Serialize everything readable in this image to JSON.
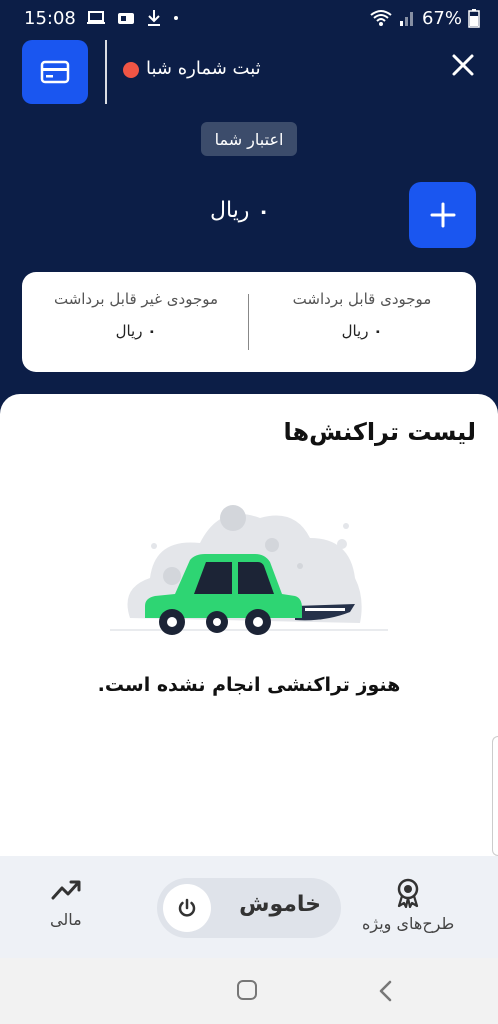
{
  "status_bar": {
    "time": "15:08",
    "battery": "67%"
  },
  "header": {
    "register_label": "ثبت شماره شبا",
    "credit_chip": "اعتبار شما",
    "balance_value": "۰",
    "balance_unit": "ریال"
  },
  "balance_card": {
    "withdrawable_title": "موجودی قابل برداشت",
    "withdrawable_value": "۰",
    "withdrawable_unit": "ریال",
    "non_withdrawable_title": "موجودی غیر قابل برداشت",
    "non_withdrawable_value": "۰",
    "non_withdrawable_unit": "ریال"
  },
  "transactions": {
    "title": "لیست تراکنش‌ها",
    "empty_message": "هنوز تراکنشی انجام نشده است."
  },
  "bottom_nav": {
    "mali_label": "مالی",
    "toggle_label": "خاموش",
    "special_label": "طرح‌های ویژه"
  },
  "colors": {
    "background": "#0c1e47",
    "accent": "#1a56f0",
    "car_green": "#2ed573",
    "dot_red": "#f05545"
  }
}
